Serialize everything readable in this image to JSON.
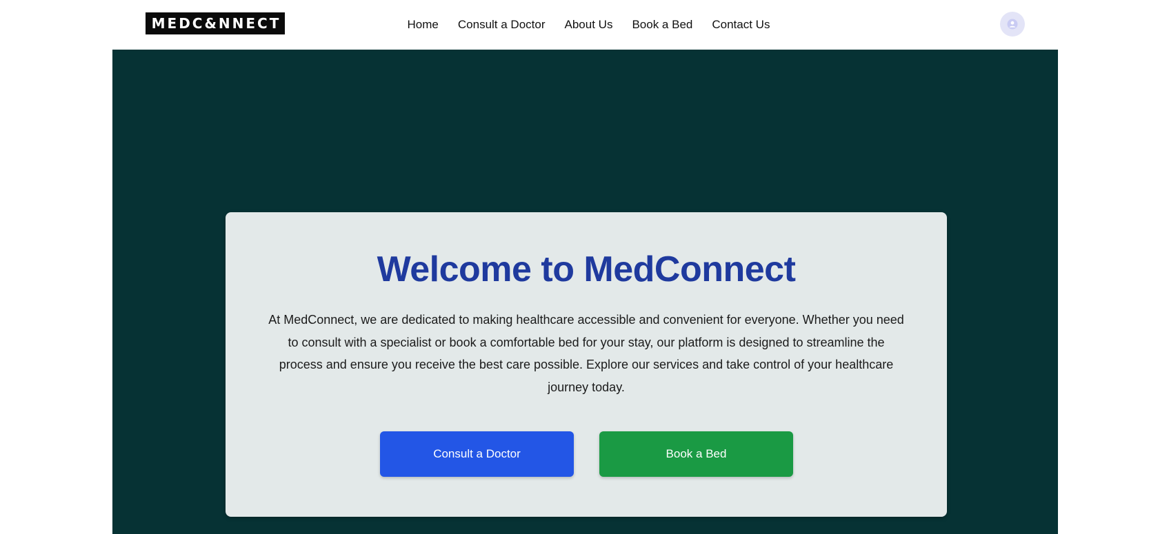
{
  "brand": {
    "logo_text": "MEDC&NNECT"
  },
  "nav": {
    "items": [
      {
        "label": "Home"
      },
      {
        "label": "Consult a Doctor"
      },
      {
        "label": "About Us"
      },
      {
        "label": "Book a Bed"
      },
      {
        "label": "Contact Us"
      }
    ],
    "avatar_icon": "user-avatar-icon"
  },
  "hero": {
    "title": "Welcome to MedConnect",
    "description": "At MedConnect, we are dedicated to making healthcare accessible and convenient for everyone. Whether you need to consult with a specialist or book a comfortable bed for your stay, our platform is designed to streamline the process and ensure you receive the best care possible. Explore our services and take control of your healthcare journey today.",
    "buttons": {
      "consult_label": "Consult a Doctor",
      "book_label": "Book a Bed"
    }
  },
  "colors": {
    "hero_background": "#063234",
    "card_background": "#e3e9e9",
    "title": "#1f3a9e",
    "consult_button": "#2356e6",
    "book_button": "#1a9a44"
  }
}
